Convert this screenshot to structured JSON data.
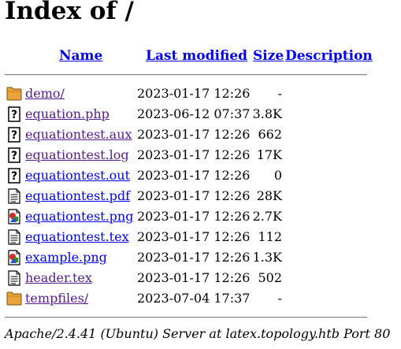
{
  "page_title": "Index of /",
  "columns": {
    "name": "Name",
    "last_modified": "Last modified",
    "size": "Size",
    "description": "Description"
  },
  "rows": [
    {
      "icon": "folder-icon",
      "name": "demo/",
      "date": "2023-01-17 12:26",
      "size": "-",
      "visited": true
    },
    {
      "icon": "unknown-file-icon",
      "name": "equation.php",
      "date": "2023-06-12 07:37",
      "size": "3.8K",
      "visited": true
    },
    {
      "icon": "unknown-file-icon",
      "name": "equationtest.aux",
      "date": "2023-01-17 12:26",
      "size": "662",
      "visited": true
    },
    {
      "icon": "unknown-file-icon",
      "name": "equationtest.log",
      "date": "2023-01-17 12:26",
      "size": "17K",
      "visited": true
    },
    {
      "icon": "unknown-file-icon",
      "name": "equationtest.out",
      "date": "2023-01-17 12:26",
      "size": "0",
      "visited": false
    },
    {
      "icon": "text-file-icon",
      "name": "equationtest.pdf",
      "date": "2023-01-17 12:26",
      "size": "28K",
      "visited": false
    },
    {
      "icon": "image-file-icon",
      "name": "equationtest.png",
      "date": "2023-01-17 12:26",
      "size": "2.7K",
      "visited": false
    },
    {
      "icon": "text-file-icon",
      "name": "equationtest.tex",
      "date": "2023-01-17 12:26",
      "size": "112",
      "visited": false
    },
    {
      "icon": "image-file-icon",
      "name": "example.png",
      "date": "2023-01-17 12:26",
      "size": "1.3K",
      "visited": false
    },
    {
      "icon": "text-file-icon",
      "name": "header.tex",
      "date": "2023-01-17 12:26",
      "size": "502",
      "visited": true
    },
    {
      "icon": "folder-icon",
      "name": "tempfiles/",
      "date": "2023-07-04 17:37",
      "size": "-",
      "visited": true
    }
  ],
  "footer": "Apache/2.4.41 (Ubuntu) Server at latex.topology.htb Port 80",
  "colors": {
    "link": "#0000ee",
    "visited_link": "#551a8b",
    "folder": "#e8a33c"
  }
}
